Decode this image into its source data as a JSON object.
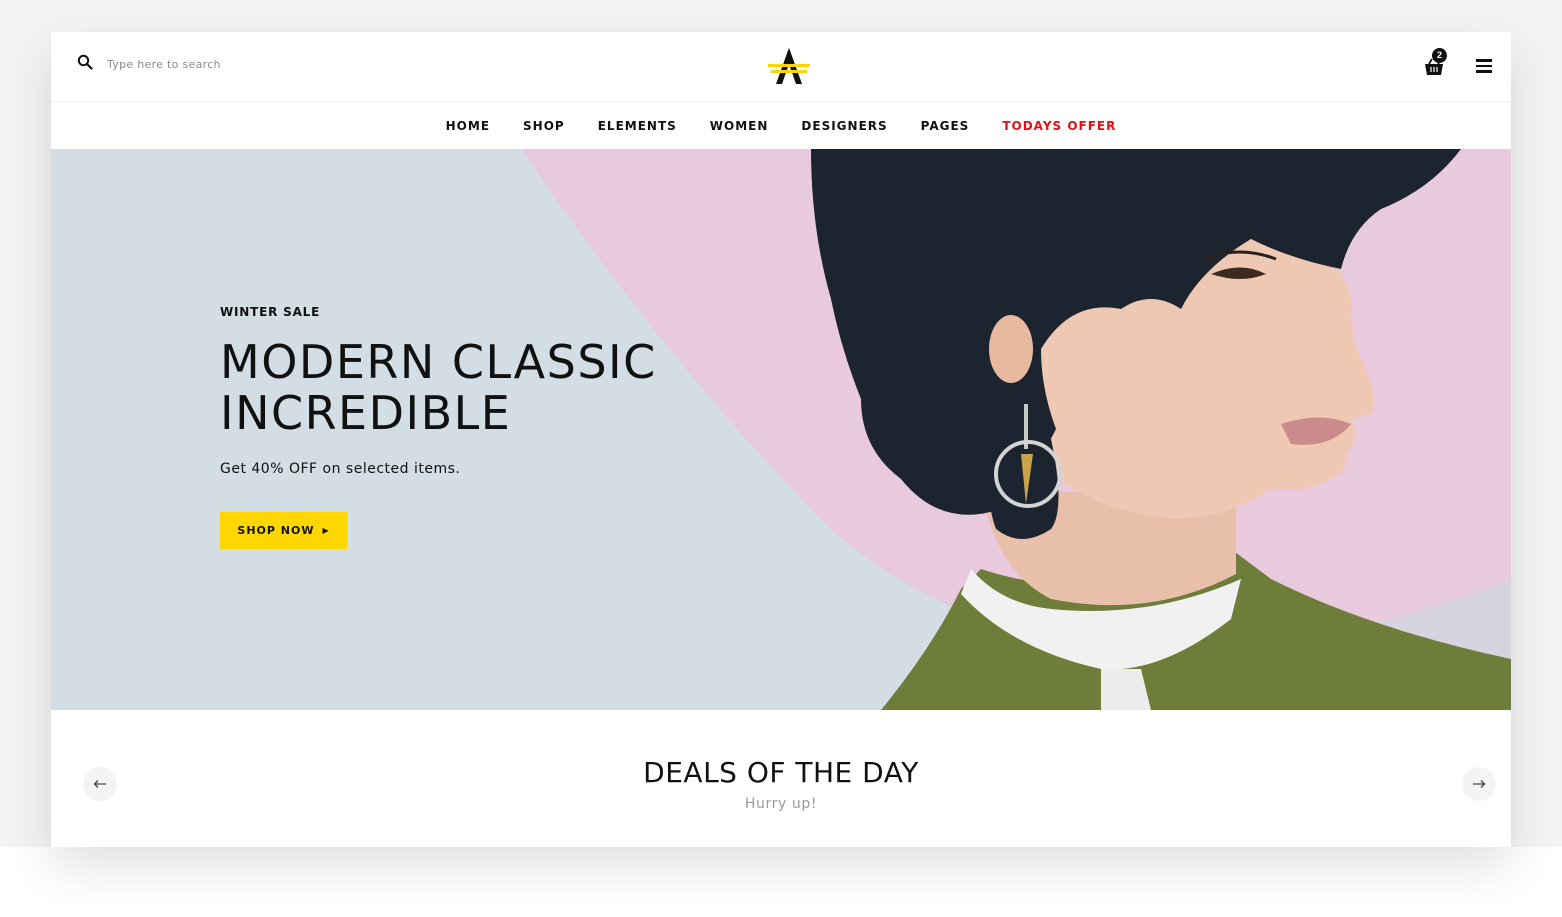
{
  "header": {
    "search_placeholder": "Type here to search",
    "cart_count": "2"
  },
  "nav": {
    "items": [
      "HOME",
      "SHOP",
      "ELEMENTS",
      "WOMEN",
      "DESIGNERS",
      "PAGES",
      "TODAYS OFFER"
    ]
  },
  "hero": {
    "eyebrow": "WINTER SALE",
    "headline_line1": "MODERN CLASSIC",
    "headline_line2": "INCREDIBLE",
    "subtext": "Get 40% OFF on selected items.",
    "cta_label": "SHOP NOW"
  },
  "deals": {
    "title": "DEALS OF THE DAY",
    "subtitle": "Hurry up!"
  },
  "colors": {
    "accent": "#ffd600",
    "offer": "#e01010",
    "hero_blue": "#d3dde4",
    "hero_pink": "#e8c9dd"
  }
}
